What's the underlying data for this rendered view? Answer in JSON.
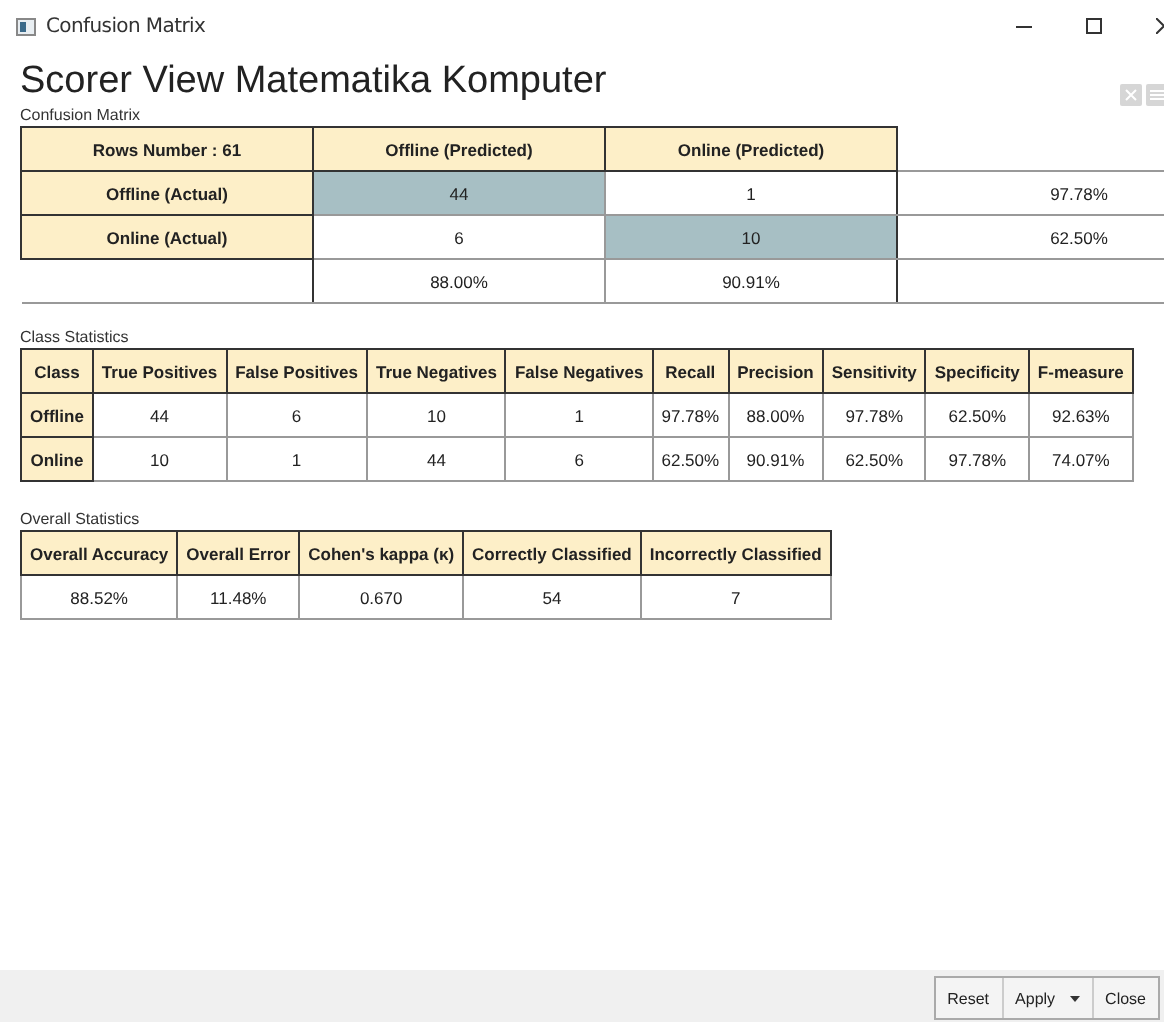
{
  "window": {
    "title": "Confusion Matrix"
  },
  "heading": "Scorer View Matematika Komputer",
  "confusion_matrix": {
    "label": "Confusion Matrix",
    "corner": "Rows Number : 61",
    "columns": [
      "Offline (Predicted)",
      "Online (Predicted)"
    ],
    "rows": [
      {
        "header": "Offline (Actual)",
        "cells": [
          {
            "value": "44",
            "highlighted": true
          },
          {
            "value": "1",
            "highlighted": false
          }
        ],
        "rate": "97.78%"
      },
      {
        "header": "Online (Actual)",
        "cells": [
          {
            "value": "6",
            "highlighted": false
          },
          {
            "value": "10",
            "highlighted": true
          }
        ],
        "rate": "62.50%"
      }
    ],
    "column_rates": [
      "88.00%",
      "90.91%"
    ]
  },
  "class_statistics": {
    "label": "Class Statistics",
    "columns": [
      "Class",
      "True Positives",
      "False Positives",
      "True Negatives",
      "False Negatives",
      "Recall",
      "Precision",
      "Sensitivity",
      "Specificity",
      "F-measure"
    ],
    "rows": [
      [
        "Offline",
        "44",
        "6",
        "10",
        "1",
        "97.78%",
        "88.00%",
        "97.78%",
        "62.50%",
        "92.63%"
      ],
      [
        "Online",
        "10",
        "1",
        "44",
        "6",
        "62.50%",
        "90.91%",
        "62.50%",
        "97.78%",
        "74.07%"
      ]
    ]
  },
  "overall_statistics": {
    "label": "Overall Statistics",
    "columns": [
      "Overall Accuracy",
      "Overall Error",
      "Cohen's kappa (κ)",
      "Correctly Classified",
      "Incorrectly Classified"
    ],
    "values": [
      "88.52%",
      "11.48%",
      "0.670",
      "54",
      "7"
    ]
  },
  "buttons": [
    {
      "label": "Reset",
      "kind": "plain"
    },
    {
      "label": "Apply",
      "kind": "dropdown"
    },
    {
      "label": "Close",
      "kind": "plain"
    }
  ]
}
